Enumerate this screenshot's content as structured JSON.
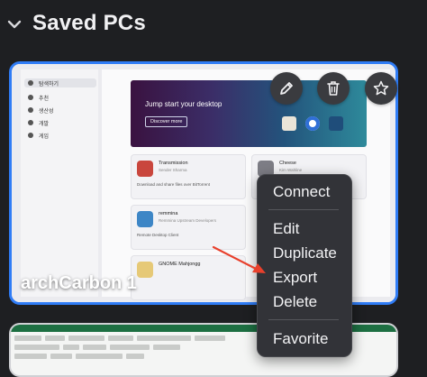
{
  "section": {
    "title": "Saved PCs",
    "collapse_icon": "chevron-down-icon"
  },
  "card": {
    "name": "archCarbon 1",
    "actions": [
      {
        "name": "edit",
        "icon": "pencil-icon"
      },
      {
        "name": "delete",
        "icon": "trash-icon"
      },
      {
        "name": "favorite",
        "icon": "star-icon"
      }
    ],
    "thumbnail": {
      "sidebar_items": [
        "탐색하기",
        "추천",
        "생산성",
        "개발",
        "게임"
      ],
      "banner_title": "Jump start your desktop",
      "banner_button": "Discover more",
      "apps": [
        {
          "name": "Transmission",
          "developer": "Sender Sharma",
          "description": "Download and share files over BitTorrent"
        },
        {
          "name": "Cheese",
          "developer": "Kim Wahline",
          "description": ""
        },
        {
          "name": "remmina",
          "developer": "Remmina Upstream Developers",
          "description": "Remote Desktop Client"
        },
        {
          "name": "GNOME Mahjongg",
          "developer": "",
          "description": ""
        }
      ]
    }
  },
  "context_menu": {
    "items": [
      "Connect",
      "Edit",
      "Duplicate",
      "Export",
      "Delete",
      "Favorite"
    ]
  },
  "colors": {
    "background": "#1e1f22",
    "selected_border": "#2f7cf6",
    "menu_bg": "#323338",
    "arrow": "#e8402c"
  }
}
